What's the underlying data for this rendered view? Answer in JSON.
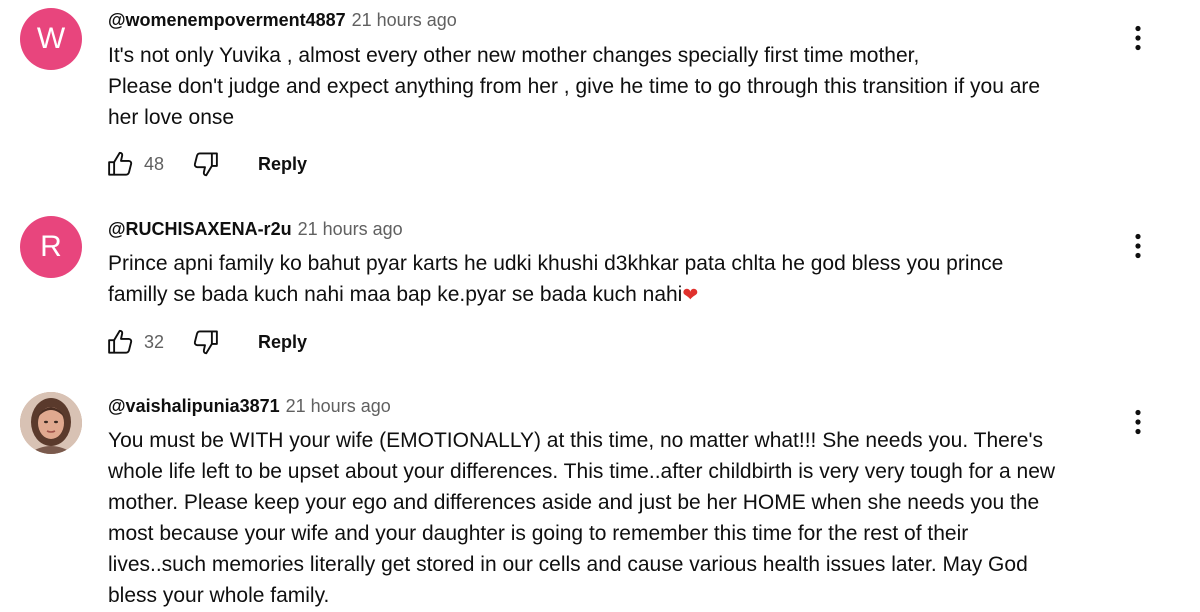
{
  "comments": [
    {
      "avatar_letter": "W",
      "avatar_color": "#e8457d",
      "author": "@womenempoverment4887",
      "time": "21 hours ago",
      "lines": [
        "It's not only Yuvika , almost every other new mother changes specially first time mother,",
        "Please don't judge and expect anything from her , give he time to go through this transition if you are",
        "her love onse"
      ],
      "likes": "48",
      "reply_label": "Reply"
    },
    {
      "avatar_letter": "R",
      "avatar_color": "#e8457d",
      "author": "@RUCHISAXENA-r2u",
      "time": "21 hours ago",
      "lines": [
        "Prince apni family  ko bahut pyar karts he udki khushi d3khkar pata chlta he god bless you prince",
        "familly se bada kuch nahi maa bap ke.pyar se bada kuch nahi"
      ],
      "heart": "❤",
      "likes": "32",
      "reply_label": "Reply"
    },
    {
      "avatar_letter": "",
      "avatar_color": "#c9a48b",
      "author": "@vaishalipunia3871",
      "time": "21 hours ago",
      "lines": [
        "You must be WITH your wife (EMOTIONALLY) at this time, no matter what!!! She needs you. There's",
        "whole life left to be upset about your differences. This time..after childbirth is very very tough for a new",
        "mother. Please keep your ego and differences aside and just be her HOME when she needs you the",
        "most because your wife and your daughter is going to remember this time for the rest of their",
        "lives..such memories literally get stored in our cells and cause various health issues later. May God",
        "bless your whole family."
      ]
    }
  ],
  "icons": {
    "like": "thumb-up-icon",
    "dislike": "thumb-down-icon",
    "more": "more-vertical-icon"
  }
}
